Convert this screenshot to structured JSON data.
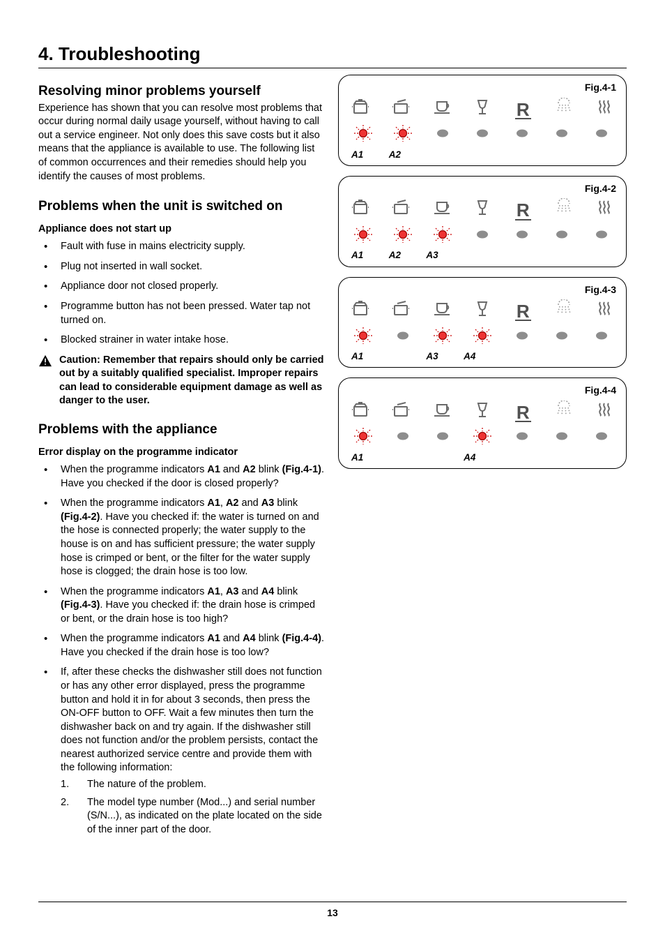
{
  "page": {
    "title": "4.  Troubleshooting",
    "number": "13"
  },
  "s1": {
    "heading": "Resolving minor problems yourself",
    "body": "Experience has shown that you can resolve most problems that occur during normal daily usage yourself, without having to call out a service engineer. Not only does this save costs but it also means that the appliance is available to use. The following list of common occurrences and their remedies should help you identify the causes of most problems."
  },
  "s2": {
    "heading": "Problems when the unit is switched on",
    "sub": "Appliance does not start up",
    "b1": "Fault with fuse in mains electricity supply.",
    "b2": "Plug not inserted in wall socket.",
    "b3": "Appliance door not closed properly.",
    "b4": "Programme button has not been pressed. Water tap not turned on.",
    "b5": "Blocked strainer in water intake hose.",
    "caution": "Caution: Remember that repairs should only be carried out by a suitably qualified specialist. Improper repairs can lead to considerable equipment damage as well as danger to the user."
  },
  "s3": {
    "heading": "Problems with the appliance",
    "sub": "Error display on the programme indicator",
    "i1": {
      "pre": "When the programme indicators ",
      "a": "A1",
      "mid": " and ",
      "b": "A2",
      "post": " blink ",
      "fig": "(Fig.4-1)",
      "tail": ". Have you checked if the door is closed properly?"
    },
    "i2": {
      "pre": "When the programme indicators ",
      "a": "A1",
      "c1": ", ",
      "b": "A2",
      "mid": " and ",
      "c": "A3",
      "post": " blink ",
      "fig": "(Fig.4-2)",
      "tail": ". Have you checked if:  the water is turned on and the hose is connected properly; the water supply to the house is on and has sufficient pressure; the water supply hose is crimped or bent, or the filter for the water supply hose is clogged; the drain hose is too low."
    },
    "i3": {
      "pre": "When the programme indicators ",
      "a": "A1",
      "c1": ", ",
      "b": "A3",
      "mid": " and ",
      "c": "A4",
      "post": " blink ",
      "fig": "(Fig.4-3)",
      "tail": ". Have you checked if:  the drain hose is crimped or bent, or the drain hose is too high?"
    },
    "i4": {
      "pre": "When the programme indicators ",
      "a": "A1",
      "mid": " and ",
      "b": "A4",
      "post": " blink ",
      "fig": "(Fig.4-4)",
      "tail": ". Have you checked if the drain hose is too low?"
    },
    "i5": "If, after these checks the dishwasher still does not function or has any other error displayed, press the programme button and hold it in for about 3 seconds, then press the ON-OFF button to OFF. Wait a few minutes then turn the dishwasher back on and try again. If the dishwasher still does not function and/or the problem persists, contact the nearest authorized service centre and provide them with the following information:",
    "o1": {
      "n": "1.",
      "t": "The nature of the problem."
    },
    "o2": {
      "n": "2.",
      "t": "The model type number (Mod...) and serial number (S/N...), as indicated on the plate located on the side of the inner part of the door."
    }
  },
  "figs": {
    "f1": {
      "label": "Fig.4-1",
      "active": [
        0,
        1
      ],
      "labs": [
        "A1",
        "A2",
        "",
        "",
        "",
        "",
        ""
      ]
    },
    "f2": {
      "label": "Fig.4-2",
      "active": [
        0,
        1,
        2
      ],
      "labs": [
        "A1",
        "A2",
        "A3",
        "",
        "",
        "",
        ""
      ]
    },
    "f3": {
      "label": "Fig.4-3",
      "active": [
        0,
        2,
        3
      ],
      "labs": [
        "A1",
        "",
        "A3",
        "A4",
        "",
        "",
        ""
      ]
    },
    "f4": {
      "label": "Fig.4-4",
      "active": [
        0,
        3
      ],
      "labs": [
        "A1",
        "",
        "",
        "A4",
        "",
        "",
        ""
      ]
    }
  },
  "icons": {
    "R": "R"
  }
}
